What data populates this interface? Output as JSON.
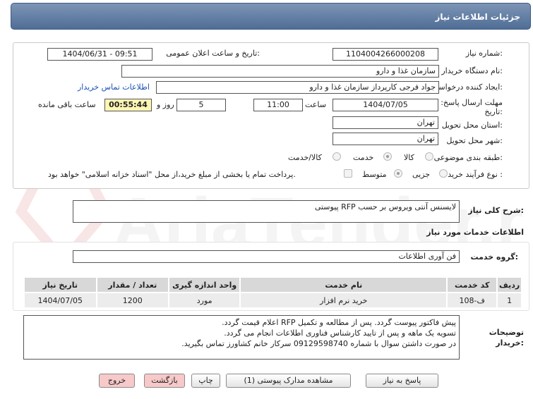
{
  "header": {
    "title": "جزئیات اطلاعات نیاز"
  },
  "form": {
    "need_number_label": "شماره نیاز:",
    "need_number": "1104004266000208",
    "announce_label": "تاریخ و ساعت اعلان عمومی:",
    "announce_value": "1404/06/31 - 09:51",
    "buyer_org_label": "نام دستگاه خریدار:",
    "buyer_org": "سازمان غذا و دارو",
    "creator_label": "ایجاد کننده درخواست:",
    "creator": "جواد فرجی کارپرداز سازمان غذا و دارو",
    "contact_link": "اطلاعات تماس خریدار",
    "deadline_label_1": "مهلت ارسال پاسخ: تا",
    "deadline_label_2": "تاریخ:",
    "deadline_date": "1404/07/05",
    "time_label": "ساعت",
    "deadline_time": "11:00",
    "days": "5",
    "days_label": "روز و",
    "remaining": "00:55:44",
    "remaining_label": "ساعت باقی مانده",
    "province_label": "استان محل تحویل:",
    "province": "تهران",
    "city_label": "شهر محل تحویل:",
    "city": "تهران",
    "category_label": "طبقه بندی موضوعی:",
    "category_options": [
      "کالا",
      "خدمت",
      "کالا/خدمت"
    ],
    "purchase_type_label": "نوع فرآیند خرید :",
    "purchase_options": [
      "جزیی",
      "متوسط"
    ],
    "treasury_note": "پرداخت تمام یا بخشی از مبلغ خرید،از محل \"اسناد خزانه اسلامی\" خواهد بود."
  },
  "summary": {
    "label": "شرح کلی نیاز:",
    "value": "لایسنس آنتی ویروس بر حسب RFP پیوستی"
  },
  "services": {
    "section_title": "اطلاعات خدمات مورد نیاز",
    "group_label": "گروه خدمت:",
    "group_value": "فن آوری اطلاعات",
    "columns": [
      "ردیف",
      "کد خدمت",
      "نام خدمت",
      "واحد اندازه گیری",
      "تعداد / مقدار",
      "تاریخ نیاز"
    ],
    "rows": [
      [
        "1",
        "ف-108",
        "خرید نرم افزار",
        "مورد",
        "1200",
        "1404/07/05"
      ]
    ]
  },
  "buyer_notes": {
    "label_1": "توضیحات",
    "label_2": "خریدار:",
    "lines": [
      "پیش فاکتور پیوست گردد. پس از مطالعه و تکمیل RFP اعلام قیمت گردد.",
      "تسویه یک ماهه و پس از تایید کارشناس فناوری اطلاعات انجام می گردد.",
      "در صورت داشتن سوال با شماره 09129598740 سرکار خانم کشاورز تماس بگیرید."
    ]
  },
  "buttons": {
    "reply": "پاسخ به نیاز",
    "attachments": "مشاهده مدارک پیوستی (1)",
    "print": "چاپ",
    "back": "بازگشت",
    "exit": "خروج"
  },
  "watermark": {
    "text": "AriaTender.net"
  },
  "colors": {
    "header": "#5a7aa3",
    "link": "#1a4fb5",
    "pink_button": "#f7c9c9"
  }
}
